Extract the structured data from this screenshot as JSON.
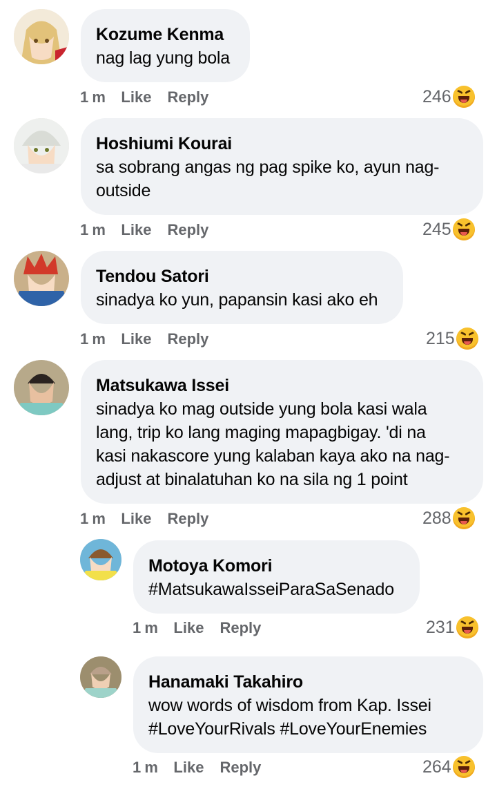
{
  "comments": [
    {
      "name": "Kozume Kenma",
      "text": [
        "nag lag yung bola"
      ],
      "time": "1 m",
      "like": "Like",
      "reply": "Reply",
      "count": "246"
    },
    {
      "name": "Hoshiumi Kourai",
      "text": [
        "sa sobrang angas ng pag spike ko, ayun nag-",
        "outside"
      ],
      "time": "1 m",
      "like": "Like",
      "reply": "Reply",
      "count": "245"
    },
    {
      "name": "Tendou Satori",
      "text": [
        "sinadya ko yun, papansin kasi ako eh"
      ],
      "time": "1 m",
      "like": "Like",
      "reply": "Reply",
      "count": "215"
    },
    {
      "name": "Matsukawa Issei",
      "text": [
        "sinadya ko mag outside yung bola kasi wala",
        "lang, trip ko lang maging mapagbigay. 'di na",
        "kasi nakascore yung kalaban kaya ako na nag-",
        "adjust at binalatuhan ko na sila ng 1 point"
      ],
      "time": "1 m",
      "like": "Like",
      "reply": "Reply",
      "count": "288"
    }
  ],
  "replies": [
    {
      "name": "Motoya Komori",
      "text": [
        "#MatsukawaIsseiParaSaSenado"
      ],
      "time": "1 m",
      "like": "Like",
      "reply": "Reply",
      "count": "231"
    },
    {
      "name": "Hanamaki Takahiro",
      "text": [
        "wow words of wisdom from Kap. Issei",
        "#LoveYourRivals #LoveYourEnemies"
      ],
      "time": "1 m",
      "like": "Like",
      "reply": "Reply",
      "count": "264"
    }
  ],
  "reaction_icon": "haha-emoji-icon",
  "colors": {
    "bubble": "#f0f2f5",
    "meta": "#65676b",
    "text": "#050505",
    "haha": "#f8c12d"
  }
}
